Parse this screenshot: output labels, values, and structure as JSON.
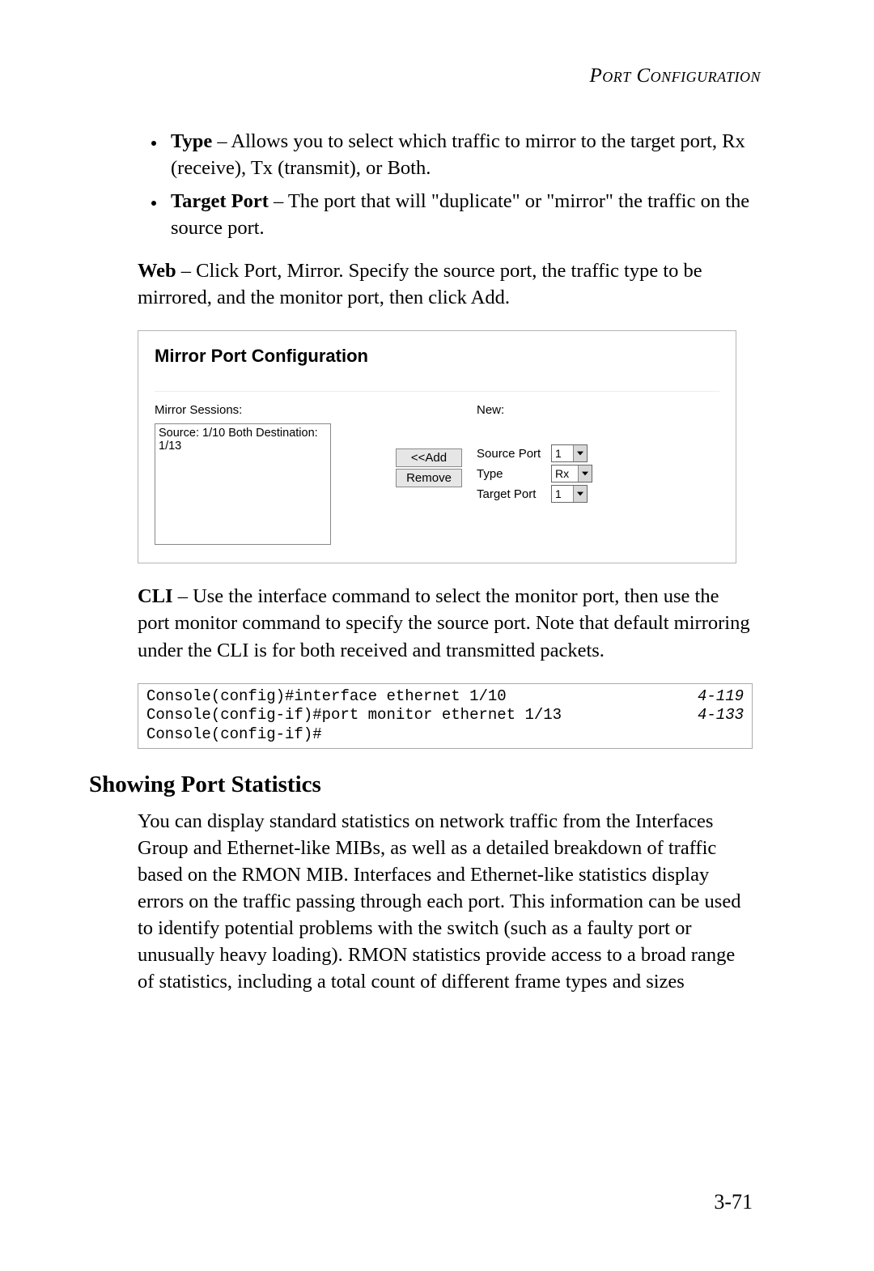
{
  "header": {
    "title": "Port Configuration"
  },
  "bullets": [
    {
      "term": "Type",
      "desc": " – Allows you to select which traffic to mirror to the target port, Rx (receive), Tx (transmit), or Both."
    },
    {
      "term": "Target Port",
      "desc": " – The port that will \"duplicate\" or \"mirror\" the traffic on the source port."
    }
  ],
  "web_para": {
    "lead": "Web",
    "rest": " – Click Port, Mirror. Specify the source port, the traffic type to be mirrored, and the monitor port, then click Add."
  },
  "ui": {
    "title": "Mirror Port Configuration",
    "sessions_label": "Mirror Sessions:",
    "session_entry": "Source: 1/10 Both Destination: 1/13",
    "new_label": "New:",
    "add_btn": "<<Add",
    "remove_btn": "Remove",
    "rows": {
      "source_port_label": "Source Port",
      "source_port_value": "1",
      "type_label": "Type",
      "type_value": "Rx",
      "target_port_label": "Target Port",
      "target_port_value": "1"
    }
  },
  "cli_para": {
    "lead": "CLI",
    "rest": " – Use the interface command to select the monitor port, then use the port monitor command to specify the source port. Note that default mirroring under the CLI is for both received and transmitted packets."
  },
  "code": {
    "lines": [
      {
        "cmd": "Console(config)#interface ethernet 1/10",
        "ref": "4-119"
      },
      {
        "cmd": "Console(config-if)#port monitor ethernet 1/13",
        "ref": "4-133"
      },
      {
        "cmd": "Console(config-if)#",
        "ref": ""
      }
    ]
  },
  "section": {
    "heading": "Showing Port Statistics",
    "text": "You can display standard statistics on network traffic from the Interfaces Group and Ethernet-like MIBs, as well as a detailed breakdown of traffic based on the RMON MIB. Interfaces and Ethernet-like statistics display errors on the traffic passing through each port. This information can be used to identify potential problems with the switch (such as a faulty port or unusually heavy loading). RMON statistics provide access to a broad range of statistics, including a total count of different frame types and sizes"
  },
  "page_number": "3-71"
}
